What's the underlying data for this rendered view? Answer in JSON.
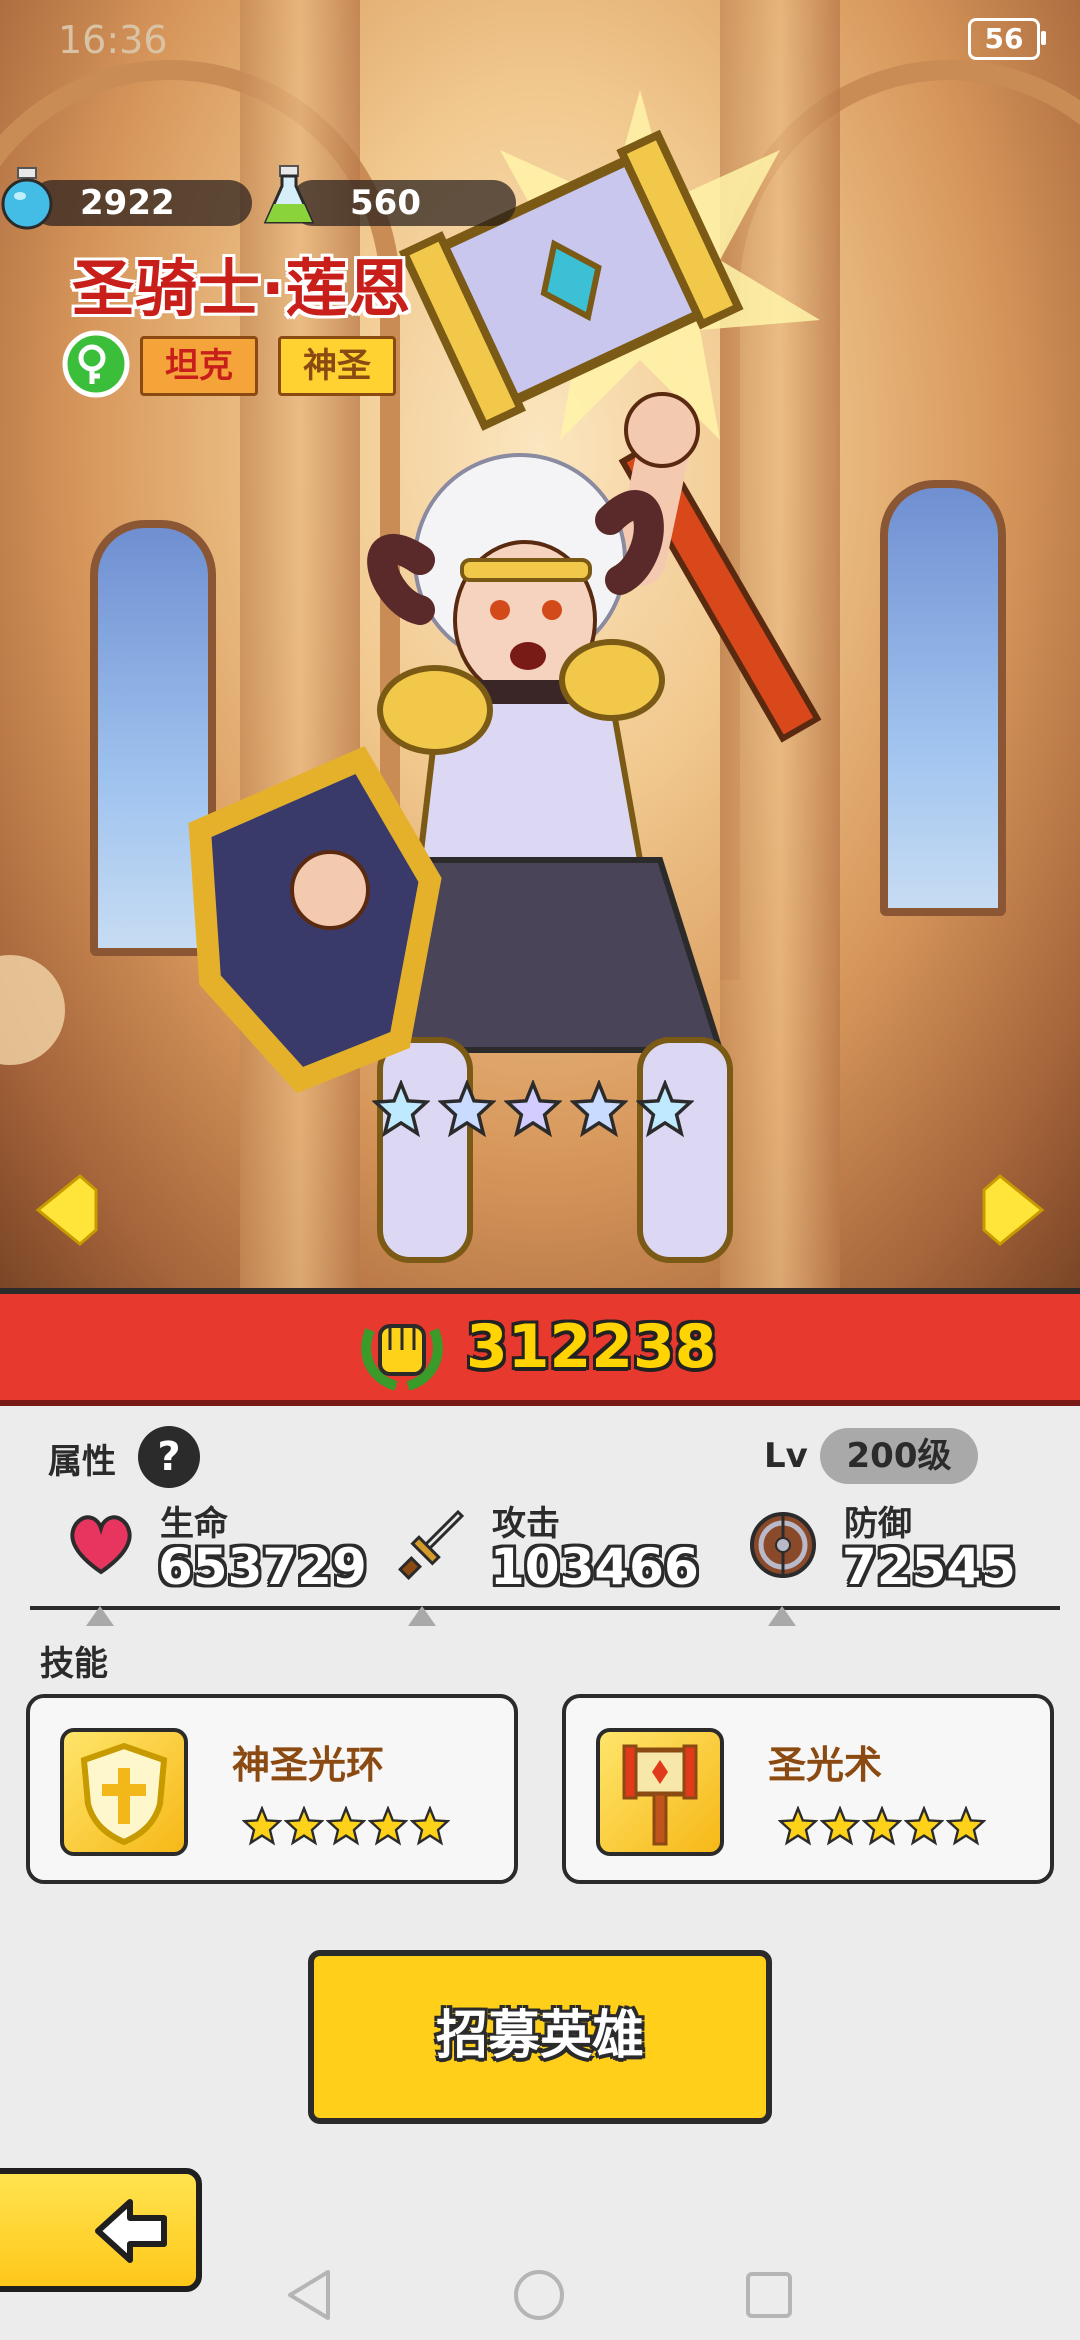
{
  "status_bar": {
    "time": "16:36",
    "battery": "56"
  },
  "resources": [
    {
      "icon": "blue-potion-icon",
      "value": "2922"
    },
    {
      "icon": "green-potion-icon",
      "value": "560"
    }
  ],
  "hero": {
    "name": "圣骑士·莲恩",
    "class_icon": "green-class-icon",
    "tags": [
      "坦克",
      "神圣"
    ],
    "stars": 5
  },
  "power": {
    "icon": "fist-laurel-icon",
    "value": "312238"
  },
  "attributes": {
    "title": "属性",
    "help": "?",
    "level_prefix": "Lv",
    "level": "200级",
    "stats": [
      {
        "icon": "heart-icon",
        "label": "生命",
        "value": "653729"
      },
      {
        "icon": "sword-icon",
        "label": "攻击",
        "value": "103466"
      },
      {
        "icon": "shield-icon",
        "label": "防御",
        "value": "72545"
      }
    ]
  },
  "skills": {
    "title": "技能",
    "items": [
      {
        "name": "神圣光环",
        "icon": "holy-shield-icon",
        "stars": 5
      },
      {
        "name": "圣光术",
        "icon": "hammer-icon",
        "stars": 5
      }
    ]
  },
  "recruit_button": "招募英雄",
  "colors": {
    "power_bar": "#e8392f",
    "accent_yellow": "#ffcf1a",
    "name_red": "#c81f1a"
  }
}
